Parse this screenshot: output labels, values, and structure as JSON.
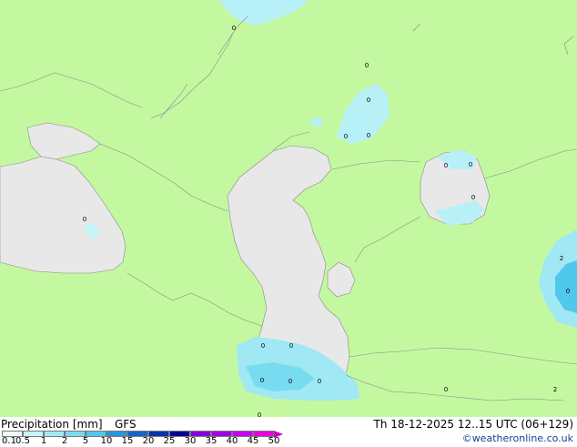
{
  "legend": {
    "title": "Precipitation [mm]",
    "model": "GFS",
    "ticks": [
      "0.1",
      "0.5",
      "1",
      "2",
      "5",
      "10",
      "15",
      "20",
      "25",
      "30",
      "35",
      "40",
      "45",
      "50"
    ],
    "colors": [
      "#f0fcfc",
      "#c8f4f8",
      "#a0e8f4",
      "#78dcf0",
      "#50c8ec",
      "#2896dc",
      "#1464c8",
      "#0a32aa",
      "#000096",
      "#8200dc",
      "#a000e6",
      "#c800f0",
      "#e600dc",
      "#c800c8"
    ]
  },
  "run_info": "Th 18-12-2025 12..15 UTC (06+129)",
  "credit": "©weatheronline.co.uk",
  "map": {
    "land_color": "#c4f8a0",
    "sea_color": "#e8e8e8",
    "precip_labels": [
      "0",
      "0",
      "0",
      "0",
      "0",
      "0",
      "0",
      "0",
      "0",
      "2",
      "0",
      "0",
      "0",
      "0",
      "0",
      "0",
      "0",
      "2",
      "0"
    ]
  }
}
